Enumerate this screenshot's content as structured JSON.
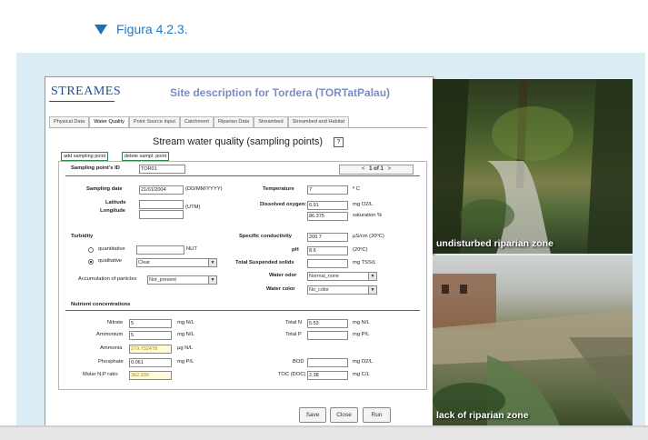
{
  "figure_caption": "Figura 4.2.3.",
  "window": {
    "logo": "STREAMES",
    "title": "Site description for Tordera (TORTatPalau)",
    "tabs": [
      "Physical Data",
      "Water Quality",
      "Point Source Input",
      "Catchment",
      "Riparian Data",
      "Streambed",
      "Streambed and Habitat"
    ],
    "active_tab": "Water Quality",
    "section_title": "Stream water quality (sampling points)",
    "help": "?",
    "add_button": "add sampling point",
    "delete_button": "delete sampl. point",
    "sampling_id_label": "Sampling point's ID",
    "sampling_id_value": "TOR01",
    "nav": {
      "prev": "<",
      "text": "1 of 1",
      "next": ">"
    },
    "sampling_date_label": "Sampling date",
    "sampling_date_value": "21/01/2004",
    "date_format": "(DD/MM/YYYY)",
    "latitude_label": "Latitude",
    "longitude_label": "Longitude",
    "utm": "(UTM)",
    "temperature_label": "Temperature",
    "temperature_value": "7",
    "temperature_unit": "º C",
    "dissolved_oxygen_label": "Dissolved oxygen:",
    "do_value": "6.91",
    "do_unit": "mg O2/L",
    "saturation_value": "86.375",
    "saturation_unit": "saturation %",
    "turbidity_label": "Turbidity",
    "quantitative_label": "quantitative",
    "ntu": "NUT",
    "qualitative_label": "qualitative",
    "qualitative_value": "Clear",
    "accumulation_label": "Accumulation of particles",
    "accumulation_value": "Not_present",
    "conductivity_label": "Specific conductivity",
    "conductivity_value": "200.7",
    "conductivity_unit": "µS/cm (20ºC)",
    "ph_label": "pH",
    "ph_value": "8.6",
    "ph_unit": "(20ºC)",
    "tss_label": "Total Suspended solids",
    "tss_unit": "mg TSS/L",
    "water_odor_label": "Water odor",
    "water_odor_value": "Normal_none",
    "water_color_label": "Water color",
    "water_color_value": "No_color",
    "nutrients_label": "Nutrient concentrations",
    "nutrients": {
      "nitrate_label": "Nitrate",
      "nitrate_value": "5",
      "nitrate_unit": "mg N/L",
      "ammonium_label": "Ammonium",
      "ammonium_value": "5",
      "ammonium_unit": "mg N/L",
      "ammonia_label": "Ammonia",
      "ammonia_value": "279.732478",
      "ammonia_unit": "µg N/L",
      "phosphate_label": "Phosphate",
      "phosphate_value": "0.061",
      "phosphate_unit": "mg P/L",
      "molar_label": "Molar N:P ratio",
      "molar_value": "362.936",
      "totaln_label": "Total N",
      "totaln_value": "5.53",
      "totaln_unit": "mg N/L",
      "totalp_label": "Total P",
      "totalp_unit": "mg P/L",
      "bod_label": "BOD",
      "bod_unit": "mg O2/L",
      "toc_label": "TOC (DOC)",
      "toc_value": "2.38",
      "toc_unit": "mg C/L"
    },
    "save": "Save",
    "close": "Close",
    "run": "Run"
  },
  "photos": {
    "top_caption": "undisturbed riparian zone",
    "bottom_caption": "lack of riparian zone"
  },
  "colors": {
    "accent": "#1f78c8",
    "panel": "#dcecf5"
  }
}
